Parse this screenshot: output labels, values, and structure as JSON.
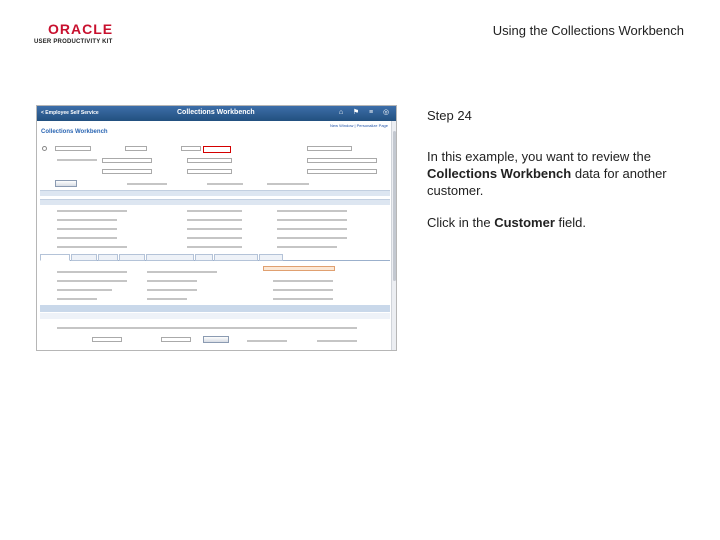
{
  "header": {
    "logo_word": "ORACLE",
    "logo_sub": "USER PRODUCTIVITY KIT",
    "title": "Using the Collections Workbench"
  },
  "screenshot": {
    "back_link": "< Employee Self Service",
    "window_title": "Collections Workbench",
    "page_title": "Collections Workbench",
    "top_links": "New Window | Personalize Page"
  },
  "instructions": {
    "step": "Step 24",
    "para1_part1": "In this example, you want to review the ",
    "para1_bold": "Collections Workbench",
    "para1_part2": " data for another customer.",
    "para2_part1": "Click in the ",
    "para2_bold": "Customer",
    "para2_part2": " field."
  },
  "colors": {
    "oracle_red": "#c8102e",
    "highlight_red": "#d40000",
    "bar_blue": "#22507f"
  }
}
